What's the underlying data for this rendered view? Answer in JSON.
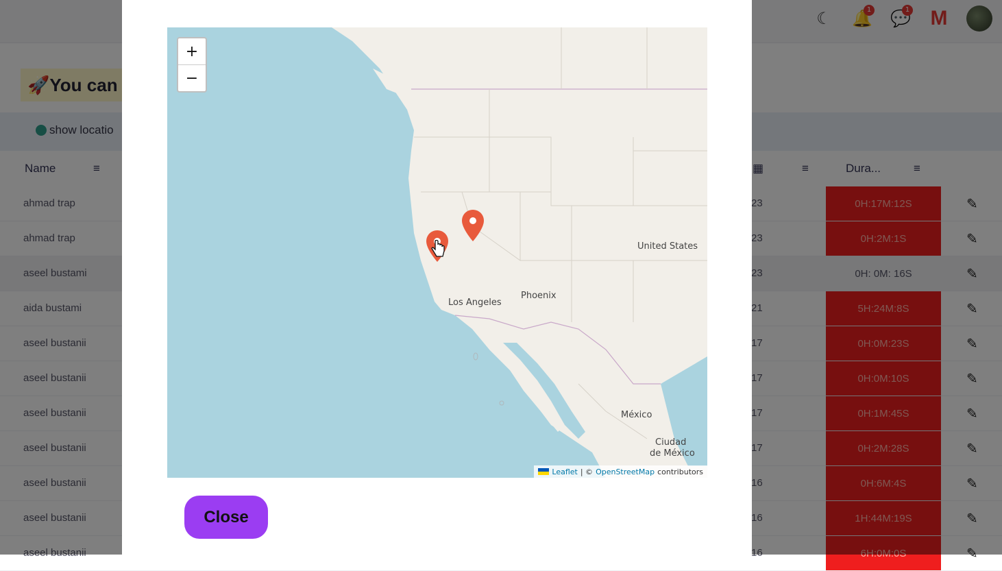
{
  "background": {
    "banner_text": "You can",
    "show_location_label": "show locatio",
    "columns": {
      "name": "Name",
      "filter_icon": "filter-icon",
      "calendar_icon": "calendar-icon",
      "duration": "Dura..."
    },
    "rows": [
      {
        "name": "ahmad trap",
        "date": "23",
        "duration": "0H:17M:12S",
        "status_color": "#ef1e1e"
      },
      {
        "name": "ahmad trap",
        "date": "23",
        "duration": "0H:2M:1S",
        "status_color": "#ef1e1e"
      },
      {
        "name": "aseel bustami",
        "date": "23",
        "duration": "0H: 0M: 16S",
        "status_color": ""
      },
      {
        "name": "aida bustami",
        "date": "21",
        "duration": "5H:24M:8S",
        "status_color": "#ef1e1e"
      },
      {
        "name": "aseel bustanii",
        "date": "17",
        "duration": "0H:0M:23S",
        "status_color": "#ef1e1e"
      },
      {
        "name": "aseel bustanii",
        "date": "17",
        "duration": "0H:0M:10S",
        "status_color": "#ef1e1e"
      },
      {
        "name": "aseel bustanii",
        "date": "17",
        "duration": "0H:1M:45S",
        "status_color": "#ef1e1e"
      },
      {
        "name": "aseel bustanii",
        "date": "17",
        "duration": "0H:2M:28S",
        "status_color": "#ef1e1e"
      },
      {
        "name": "aseel bustanii",
        "date": "16",
        "duration": "0H:6M:4S",
        "status_color": "#ef1e1e"
      },
      {
        "name": "aseel bustanii",
        "date": "16",
        "duration": "1H:44M:19S",
        "status_color": "#ef1e1e"
      },
      {
        "name": "aseel bustanii",
        "date": "16",
        "duration": "6H:0M:0S",
        "status_color": "#ef1e1e"
      }
    ],
    "topbar": {
      "notifications_badge": "1",
      "messages_badge": "1"
    }
  },
  "modal": {
    "map": {
      "zoom_in": "+",
      "zoom_out": "−",
      "labels": {
        "united_states": "United States",
        "los_angeles": "Los Angeles",
        "phoenix": "Phoenix",
        "mexico": "México",
        "ciudad_de_mexico_1": "Ciudad",
        "ciudad_de_mexico_2": "de México"
      },
      "attribution": {
        "leaflet": "Leaflet",
        "separator": "| ©",
        "osm": "OpenStreetMap",
        "contributors": "contributors"
      },
      "markers": 2,
      "marker_color": "#e85a3c"
    },
    "close_label": "Close"
  }
}
